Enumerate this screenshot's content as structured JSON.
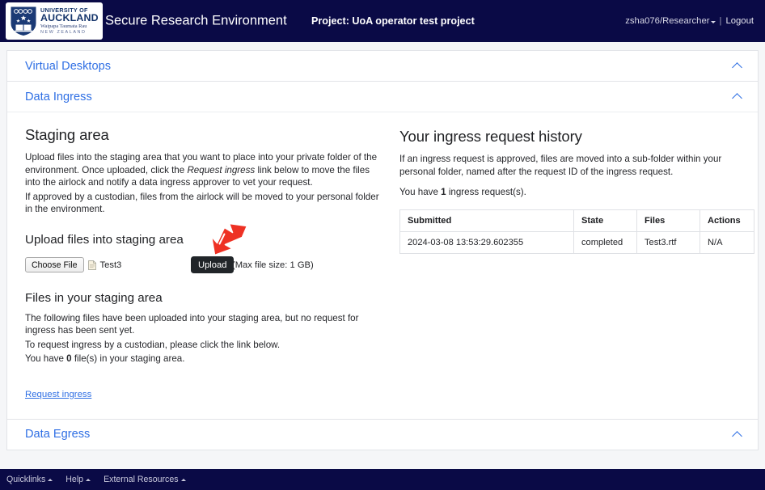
{
  "header": {
    "logo": {
      "line1": "UNIVERSITY OF",
      "line2": "AUCKLAND",
      "line3": "Waipapa Taumata Rau",
      "line4": "NEW ZEALAND"
    },
    "app_title": "Secure Research Environment",
    "project_title": "Project: UoA operator test project",
    "user": "zsha076/Researcher",
    "separator": "|",
    "logout": "Logout",
    "bg_color": "#0a0a46"
  },
  "panels": {
    "virtual_desktops": {
      "title": "Virtual Desktops"
    },
    "data_ingress": {
      "title": "Data Ingress"
    },
    "data_egress": {
      "title": "Data Egress"
    }
  },
  "staging": {
    "heading": "Staging area",
    "para1_a": "Upload files into the staging area that you want to place into your private folder of the environment. Once uploaded, click the ",
    "para1_em": "Request ingress",
    "para1_b": " link below to move the files into the airlock and notify a data ingress approver to vet your request.",
    "para2": "If approved by a custodian, files from the airlock will be moved to your personal folder in the environment.",
    "upload_heading": "Upload files into staging area",
    "choose_file_label": "Choose File",
    "selected_file": "Test3",
    "upload_label": "Upload",
    "max_file_size": "(Max file size: 1 GB)",
    "files_heading": "Files in your staging area",
    "files_para1": "The following files have been uploaded into your staging area, but no request for ingress has been sent yet.",
    "files_para2": "To request ingress by a custodian, please click the link below.",
    "files_count_pre": "You have ",
    "files_count": "0",
    "files_count_post": " file(s) in your staging area.",
    "request_ingress_link": "Request ingress"
  },
  "history": {
    "heading": "Your ingress request history",
    "para1": "If an ingress request is approved, files are moved into a sub-folder within your personal folder, named after the request ID of the ingress request.",
    "count_pre": "You have ",
    "count": "1",
    "count_post": " ingress request(s).",
    "columns": [
      "Submitted",
      "State",
      "Files",
      "Actions"
    ],
    "rows": [
      {
        "submitted": "2024-03-08 13:53:29.602355",
        "state": "completed",
        "files": "Test3.rtf",
        "actions": "N/A"
      }
    ]
  },
  "footer": {
    "items": [
      {
        "label": "Quicklinks"
      },
      {
        "label": "Help"
      },
      {
        "label": "External Resources"
      }
    ]
  },
  "colors": {
    "accent_link": "#2f6fe4",
    "navy": "#0a0a46",
    "arrow_red": "#ee3124",
    "dark_button": "#212529"
  }
}
